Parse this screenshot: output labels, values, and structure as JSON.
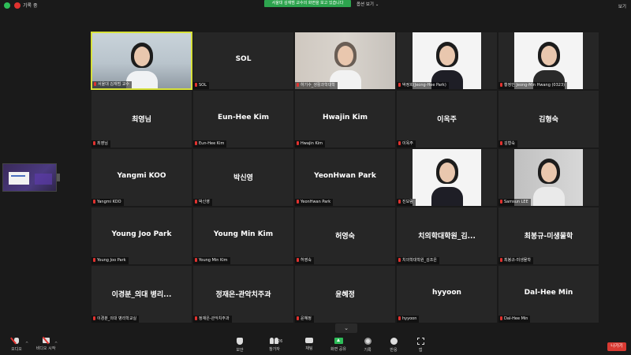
{
  "topbar": {
    "rec_label": "기록 중",
    "share_banner": "서울대 김재범 교수의 화면을 보고 있습니다",
    "view_options": "옵션 보기 ⌄",
    "view_right": "보기"
  },
  "tiles": [
    {
      "name": "서울대 김재범 교수",
      "label": "서울대 김재범 교수",
      "video": "office",
      "active": true
    },
    {
      "name": "SOL",
      "label": "SOL"
    },
    {
      "name": "하기수_생활과학대학",
      "label": "하기수_생활과학대학",
      "video": "blur"
    },
    {
      "name": "박정희",
      "label": "박정희(Jeong-Hee Park)",
      "video": "white"
    },
    {
      "name": "황정민",
      "label": "황정민 Jeong-Min Hwang (0323)",
      "video": "white2"
    },
    {
      "name": "최영님",
      "label": "최영님"
    },
    {
      "name": "Eun-Hee Kim",
      "label": "Eun-Hee Kim"
    },
    {
      "name": "Hwajin Kim",
      "label": "Hwajin Kim"
    },
    {
      "name": "이옥주",
      "label": "이옥주"
    },
    {
      "name": "김형숙",
      "label": "김형숙"
    },
    {
      "name": "Yangmi KOO",
      "label": "Yangmi KOO"
    },
    {
      "name": "박신영",
      "label": "박신영"
    },
    {
      "name": "YeonHwan Park",
      "label": "YeonHwan Park"
    },
    {
      "name": "진보람",
      "label": "진보람",
      "video": "white3"
    },
    {
      "name": "Samsun LEE",
      "label": "Samsun LEE",
      "video": "gray"
    },
    {
      "name": "Young Joo Park",
      "label": "Young Joo Park"
    },
    {
      "name": "Young Min Kim",
      "label": "Young Min Kim"
    },
    {
      "name": "허영숙",
      "label": "허영숙"
    },
    {
      "name": "치의학대학원_김...",
      "label": "치의학대학원_김조은"
    },
    {
      "name": "최봉규-미생물학",
      "label": "최봉규-미생물학"
    },
    {
      "name": "이경분_의대 병리...",
      "label": "이경분_의대 병리학교실"
    },
    {
      "name": "정재은-관악치주과",
      "label": "정재은-관악치주과"
    },
    {
      "name": "윤혜정",
      "label": "윤혜정"
    },
    {
      "name": "hyyoon",
      "label": "hyyoon"
    },
    {
      "name": "Dal-Hee Min",
      "label": "Dal-Hee Min"
    }
  ],
  "toolbar": {
    "audio": "오디오",
    "video": "비디오 시작",
    "security": "보안",
    "participants": "참가자",
    "participants_count": "26",
    "chat": "채팅",
    "share": "화면 공유",
    "record": "기록",
    "reactions": "반응",
    "apps": "앱",
    "leave": "나가기",
    "caret": "⌄"
  },
  "colors": {
    "active_border": "#d7e13a",
    "share_green": "#2da44e",
    "leave_red": "#d93a32"
  }
}
